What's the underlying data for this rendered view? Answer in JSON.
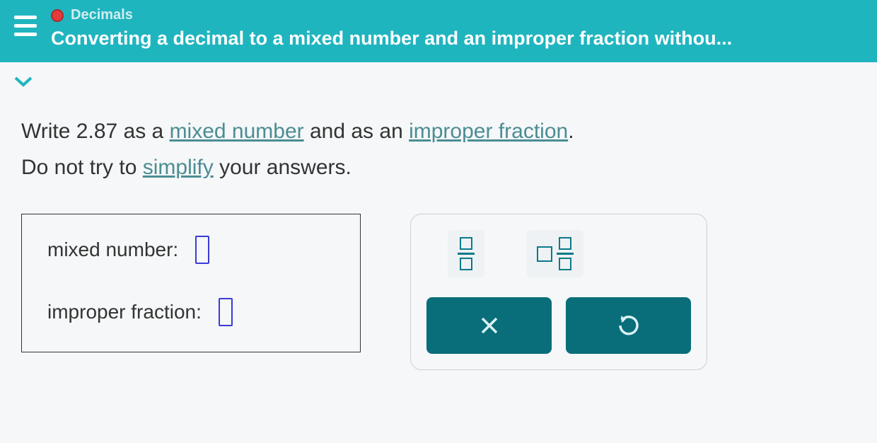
{
  "header": {
    "category": "Decimals",
    "title": "Converting a decimal to a mixed number and an improper fraction withou..."
  },
  "question": {
    "prefix": "Write ",
    "value": "2.87",
    "mid1": " as a ",
    "link1": "mixed number",
    "mid2": " and as an ",
    "link2": "improper fraction",
    "end1": ".",
    "line2a": "Do not try to ",
    "link3": "simplify",
    "line2b": " your answers."
  },
  "answers": {
    "mixed_label": "mixed number:",
    "improper_label": "improper fraction:"
  }
}
